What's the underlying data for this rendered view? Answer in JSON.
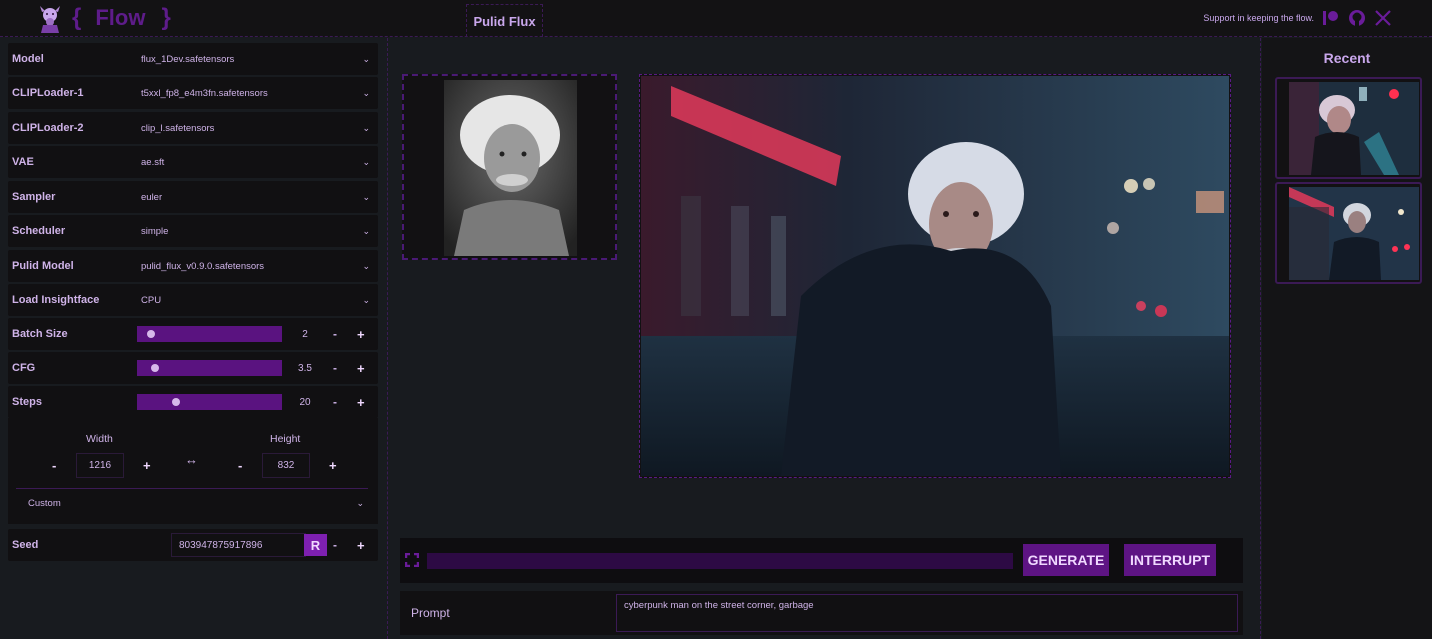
{
  "header": {
    "logo_brace_left": "{",
    "logo_text": "Flow",
    "logo_brace_right": "}",
    "logo_icon": "goat-icon",
    "active_tab": "Pulid Flux",
    "support_text": "Support in keeping the flow.",
    "social_icons": [
      "patreon-icon",
      "github-icon",
      "x-icon"
    ]
  },
  "settings": {
    "dropdowns": [
      {
        "label": "Model",
        "value": "flux_1Dev.safetensors"
      },
      {
        "label": "CLIPLoader-1",
        "value": "t5xxl_fp8_e4m3fn.safetensors"
      },
      {
        "label": "CLIPLoader-2",
        "value": "clip_l.safetensors"
      },
      {
        "label": "VAE",
        "value": "ae.sft"
      },
      {
        "label": "Sampler",
        "value": "euler"
      },
      {
        "label": "Scheduler",
        "value": "simple"
      },
      {
        "label": "Pulid Model",
        "value": "pulid_flux_v0.9.0.safetensors"
      },
      {
        "label": "Load Insightface",
        "value": "CPU"
      }
    ],
    "sliders": [
      {
        "label": "Batch Size",
        "value": "2",
        "fraction": 0.03
      },
      {
        "label": "CFG",
        "value": "3.5",
        "fraction": 0.06
      },
      {
        "label": "Steps",
        "value": "20",
        "fraction": 0.22
      }
    ],
    "minus": "-",
    "plus": "+",
    "dimensions": {
      "width_label": "Width",
      "width_value": "1216",
      "height_label": "Height",
      "height_value": "832",
      "swap_symbol": "↔",
      "preset": "Custom"
    },
    "seed": {
      "label": "Seed",
      "value": "803947875917896",
      "random_label": "R"
    },
    "chevron": "⌄"
  },
  "main": {
    "input_image_alt": "Reference portrait (black and white)",
    "output_image_alt": "Generated image: man on cyberpunk street at night",
    "generate_label": "GENERATE",
    "interrupt_label": "INTERRUPT",
    "progress": 0,
    "prompt_label": "Prompt",
    "prompt_value": "cyberpunk man on the street corner, garbage"
  },
  "recent": {
    "title": "Recent",
    "items": [
      {
        "alt": "Recent generation 1"
      },
      {
        "alt": "Recent generation 2"
      }
    ]
  }
}
